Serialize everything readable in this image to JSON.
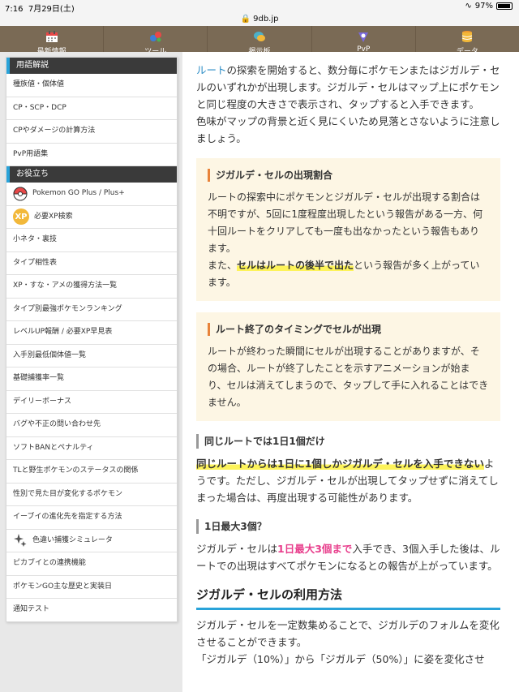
{
  "status": {
    "time": "7:16",
    "date": "7月29日(土)",
    "battery": "97%"
  },
  "url": "9db.jp",
  "nav": [
    {
      "label": "最新情報",
      "icon": "calendar-icon"
    },
    {
      "label": "ツール",
      "icon": "tools-icon"
    },
    {
      "label": "掲示板",
      "icon": "chat-icon"
    },
    {
      "label": "PvP",
      "icon": "pvp-icon"
    },
    {
      "label": "データ",
      "icon": "database-icon"
    }
  ],
  "sidebar": {
    "glossary_heading": "用語解説",
    "glossary_items": [
      "種族値・個体値",
      "CP・SCP・DCP",
      "CPやダメージの計算方法",
      "PvP用語集"
    ],
    "useful_heading": "お役立ち",
    "useful_items": [
      "Pokemon GO Plus / Plus+",
      "必要XP検索",
      "小ネタ・裏技",
      "タイプ相性表",
      "XP・すな・アメの獲得方法一覧",
      "タイプ別最強ポケモンランキング",
      "レベルUP報酬 / 必要XP早見表",
      "入手別最低個体値一覧",
      "基礎捕獲率一覧",
      "デイリーボーナス",
      "バグや不正の問い合わせ先",
      "ソフトBANとペナルティ",
      "TLと野生ポケモンのステータスの関係",
      "性別で見た目が変化するポケモン",
      "イーブイの進化先を指定する方法",
      "色違い捕獲シミュレータ",
      "ピカブイとの連携機能",
      "ポケモンGO主な歴史と実装日",
      "通知テスト"
    ],
    "xp_badge": "XP"
  },
  "content": {
    "intro_link": "ルート",
    "intro_text": "の探索を開始すると、数分毎にポケモンまたはジガルデ・セルのいずれかが出現します。ジガルデ・セルはマップ上にポケモンと同じ程度の大きさで表示され、タップすると入手できます。",
    "intro_text2": "色味がマップの背景と近く見にくいため見落とさないように注意しましょう。",
    "box1_title": "ジガルデ・セルの出現割合",
    "box1_text": "ルートの探索中にポケモンとジガルデ・セルが出現する割合は不明ですが、5回に1度程度出現したという報告がある一方、何十回ルートをクリアしても一度も出なかったという報告もあります。",
    "box1_text2_pre": "また、",
    "box1_text2_hl": "セルはルートの後半で出た",
    "box1_text2_post": "という報告が多く上がっています。",
    "box2_title": "ルート終了のタイミングでセルが出現",
    "box2_text": "ルートが終わった瞬間にセルが出現することがありますが、その場合、ルートが終了したことを示すアニメーションが始まり、セルは消えてしまうので、タップして手に入れることはできません。",
    "h4_1": "同じルートでは1日1個だけ",
    "p1_hl": "同じルートからは1日に1個しかジガルデ・セルを入手できない",
    "p1_rest": "ようです。ただし、ジガルデ・セルが出現してタップせずに消えてしまった場合は、再度出現する可能性があります。",
    "h4_2": "1日最大3個？",
    "p2_pre": "ジガルデ・セルは",
    "p2_pink": "1日最大3個まで",
    "p2_post": "入手でき、3個入手した後は、ルートでの出現はすべてポケモンになるとの報告が上がっています。",
    "h3": "ジガルデ・セルの利用方法",
    "p3": "ジガルデ・セルを一定数集めることで、ジガルデのフォルムを変化させることができます。",
    "p4": "「ジガルデ（10%）」から「ジガルデ（50%）」に姿を変化させ"
  },
  "colors": {
    "accent": "#29a3d9",
    "nav_bg": "#7a6a55",
    "box_bg": "#fdf6e4",
    "box_bar": "#e8833a",
    "highlight": "#fdf35a",
    "pink": "#e83e8c"
  }
}
